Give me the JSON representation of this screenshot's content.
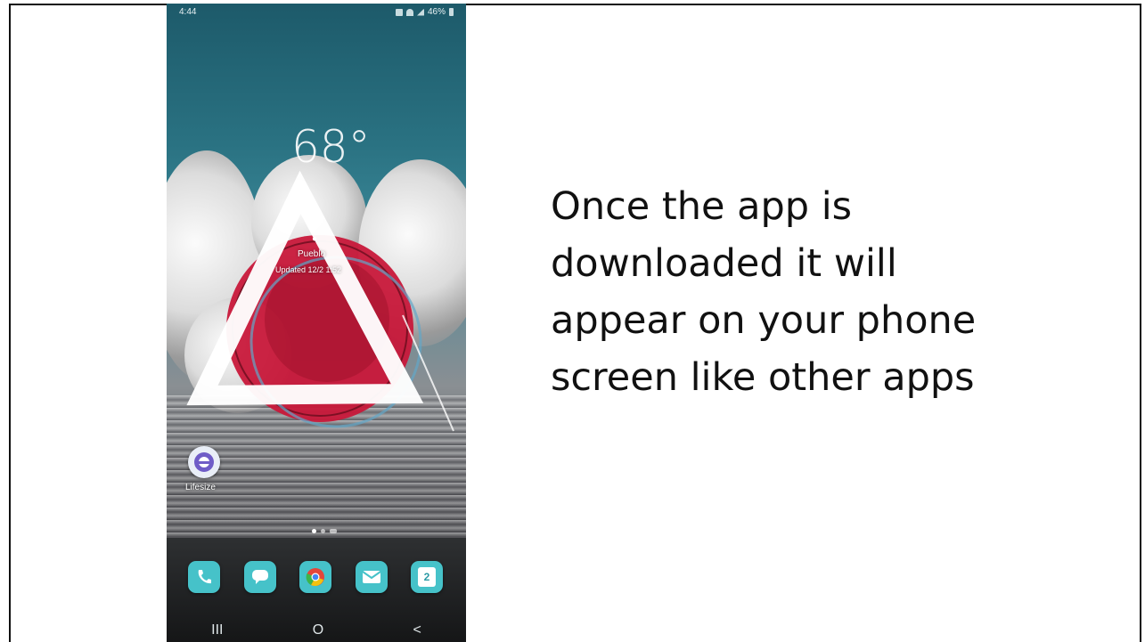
{
  "slide": {
    "caption": "Once the app is\ndownloaded it will\nappear on your phone\nscreen like other apps"
  },
  "phone": {
    "status_bar": {
      "time": "4:44",
      "battery": "46%"
    },
    "weather": {
      "temperature": "68°",
      "location": "Pueblo",
      "updated": "Updated 12/2 1:52"
    },
    "home_apps": [
      {
        "label": "Lifesize",
        "icon": "lifesize-app-icon"
      }
    ],
    "dock": [
      {
        "icon": "phone-icon",
        "color": "#2fb5c0"
      },
      {
        "icon": "messages-icon",
        "color": "#2fb5c0"
      },
      {
        "icon": "chrome-icon",
        "color": "#2fb5c0"
      },
      {
        "icon": "email-icon",
        "color": "#2fb5c0"
      },
      {
        "icon": "calendar-icon",
        "color": "#2fb5c0",
        "text": "2"
      }
    ],
    "nav_bar": {
      "recents": "III",
      "home": "O",
      "back": "<"
    }
  }
}
